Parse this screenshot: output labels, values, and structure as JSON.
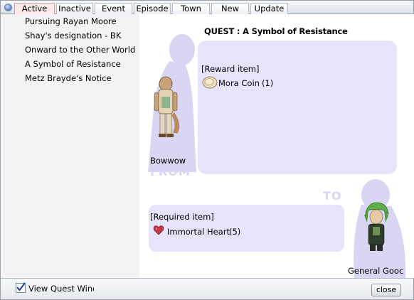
{
  "tabs": [
    {
      "label": "Active",
      "active": true
    },
    {
      "label": "Inactive"
    },
    {
      "label": "Event"
    },
    {
      "label": "Episode"
    },
    {
      "label": "Town"
    },
    {
      "label": "New"
    },
    {
      "label": "Update"
    }
  ],
  "quest_list": [
    "Pursuing Rayan Moore",
    "Shay's designation - BK",
    "Onward to the Other World",
    "A Symbol of Resistance",
    "Metz Brayde's Notice"
  ],
  "detail": {
    "title": "QUEST : A Symbol of Resistance",
    "from_npc": "Bowwow",
    "to_npc": "General Gooc",
    "ghost_from": "FROM",
    "ghost_to": "TO",
    "reward": {
      "label": "[Reward item]",
      "item_name": "Mora Coin",
      "item_count": "(1)",
      "icon": "coin-icon"
    },
    "required": {
      "label": "[Required item]",
      "item_name": "Immortal Heart",
      "item_count": "(5)",
      "icon": "heart-icon"
    }
  },
  "footer": {
    "checkbox_label": "View Quest Window",
    "checkbox_checked": true,
    "close_label": "close"
  },
  "colors": {
    "active_tab": "#fde9ea",
    "panel_box": "#e6e3fb",
    "silhouette": "#d9d6f3"
  }
}
